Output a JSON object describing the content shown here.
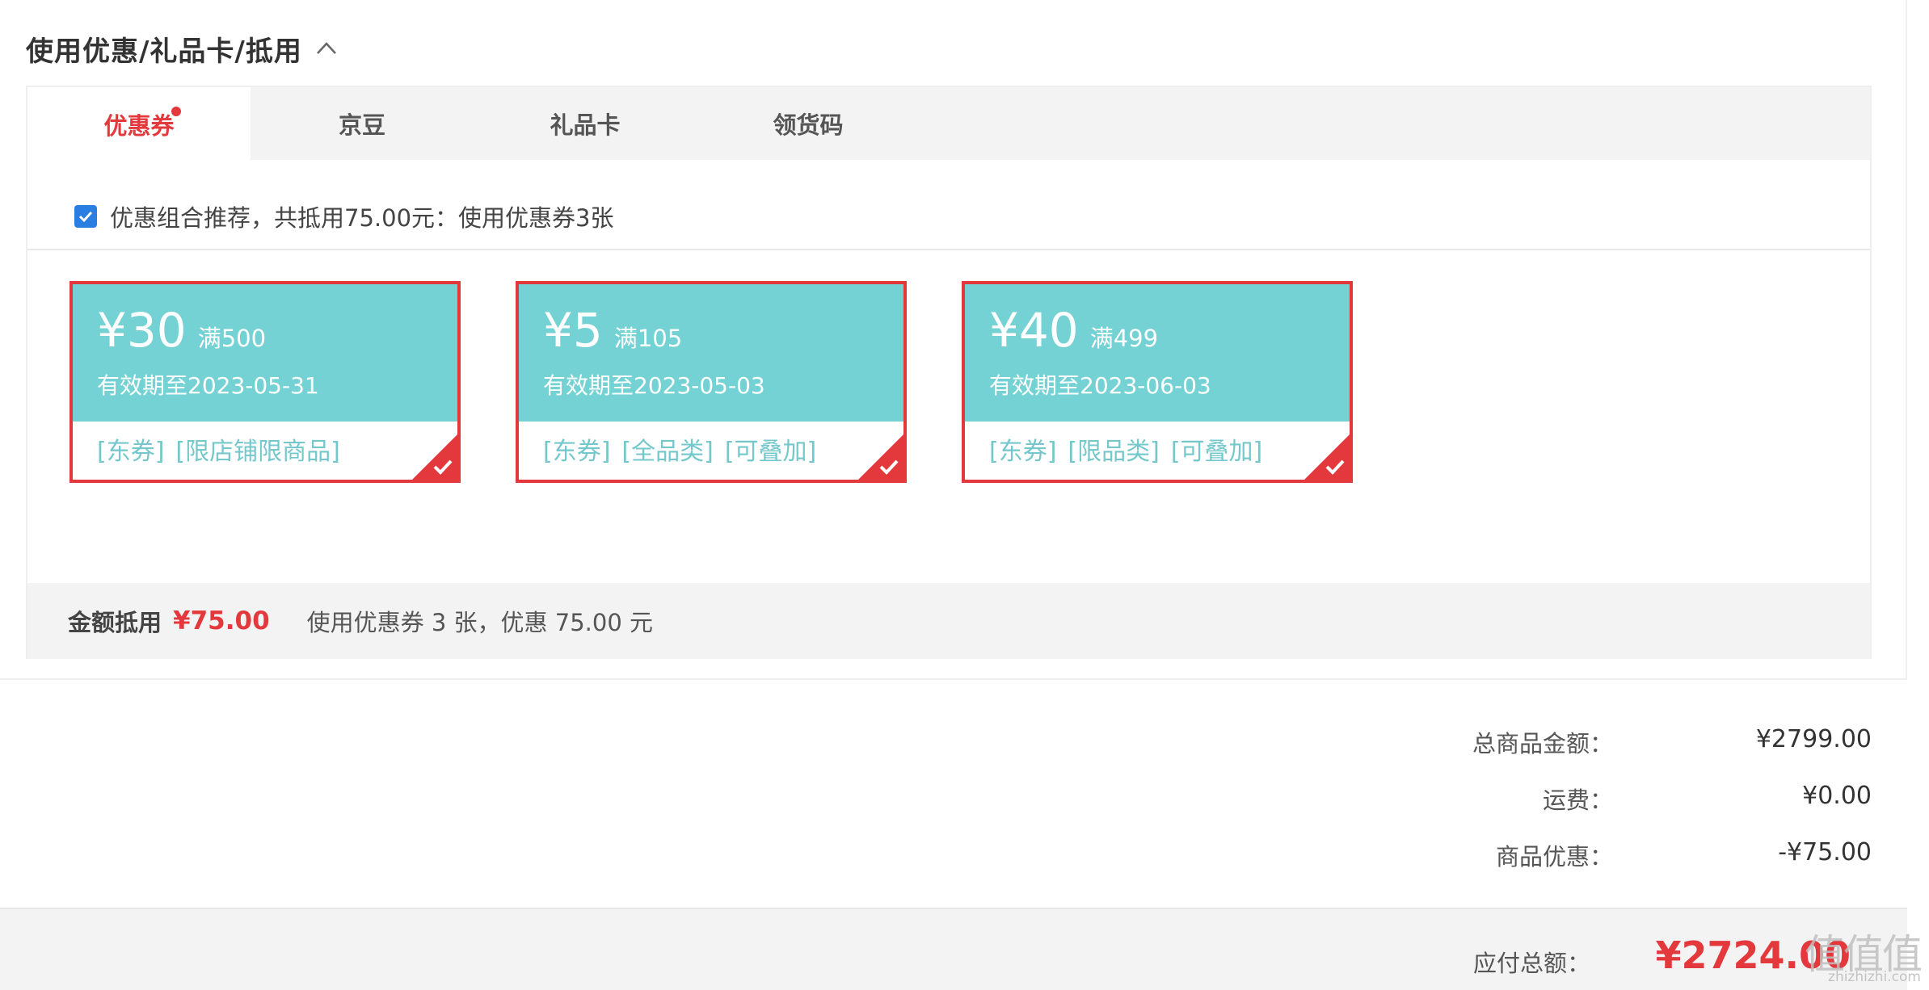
{
  "header": {
    "title": "使用优惠/礼品卡/抵用"
  },
  "tabs": [
    {
      "label": "优惠券",
      "active": true,
      "has_dot": true
    },
    {
      "label": "京豆",
      "active": false
    },
    {
      "label": "礼品卡",
      "active": false
    },
    {
      "label": "领货码",
      "active": false
    }
  ],
  "recommend": {
    "checked": true,
    "text": "优惠组合推荐，共抵用75.00元：使用优惠券3张"
  },
  "coupons": [
    {
      "amount": "¥30",
      "condition": "满500",
      "validity": "有效期至2023-05-31",
      "tags": [
        "[东券]",
        "[限店铺限商品]"
      ],
      "selected": true
    },
    {
      "amount": "¥5",
      "condition": "满105",
      "validity": "有效期至2023-05-03",
      "tags": [
        "[东券]",
        "[全品类]",
        "[可叠加]"
      ],
      "selected": true
    },
    {
      "amount": "¥40",
      "condition": "满499",
      "validity": "有效期至2023-06-03",
      "tags": [
        "[东券]",
        "[限品类]",
        "[可叠加]"
      ],
      "selected": true
    }
  ],
  "footer": {
    "label": "金额抵用",
    "amount": "¥75.00",
    "detail": "使用优惠券 3 张，优惠 75.00 元"
  },
  "summary": [
    {
      "label": "总商品金额：",
      "value": "¥2799.00"
    },
    {
      "label": "运费：",
      "value": "¥0.00"
    },
    {
      "label": "商品优惠：",
      "value": "-¥75.00"
    }
  ],
  "payable": {
    "label": "应付总额：",
    "value": "¥2724.00"
  },
  "watermark": {
    "chars": "值值值",
    "url": "zhizhizhi.com"
  },
  "colors": {
    "accent": "#e4393c",
    "coupon_bg": "#74d2d4",
    "checkbox": "#2a7de1",
    "tab_bar": "#f3f3f3"
  },
  "icons": {
    "collapse": "chevron-up-icon",
    "selected_corner": "checkmark-icon",
    "checkbox": "checkbox-checked-icon"
  }
}
